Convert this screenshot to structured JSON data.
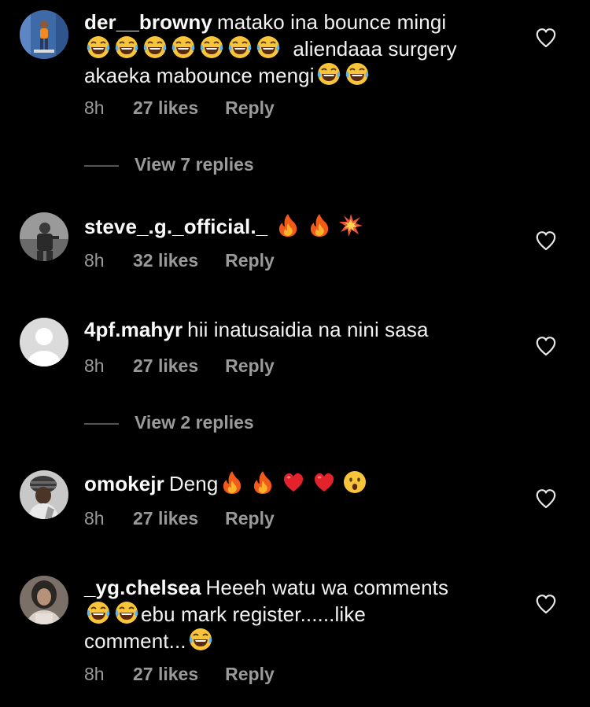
{
  "comments": [
    {
      "username": "der__browny",
      "text_1": "matako ina bounce mingi",
      "text_2": "aliendaaa surgery",
      "text_3": "akaeka mabounce mengi",
      "time": "8h",
      "likes": "27 likes",
      "reply": "Reply",
      "view_replies": "View 7 replies"
    },
    {
      "username": "steve_.g._official._",
      "text_1": "",
      "time": "8h",
      "likes": "32 likes",
      "reply": "Reply"
    },
    {
      "username": "4pf.mahyr",
      "text_1": "hii inatusaidia na nini sasa",
      "time": "8h",
      "likes": "27 likes",
      "reply": "Reply",
      "view_replies": "View 2 replies"
    },
    {
      "username": "omokejr",
      "text_1": "Deng",
      "time": "8h",
      "likes": "27 likes",
      "reply": "Reply"
    },
    {
      "username": "_yg.chelsea",
      "text_1": "Heeeh watu wa comments",
      "text_2": "ebu mark register......like",
      "text_3": "comment...",
      "time": "8h",
      "likes": "27 likes",
      "reply": "Reply"
    }
  ],
  "icons": {
    "like": "heart-outline-icon",
    "laugh": "face-with-tears-of-joy-emoji",
    "fire": "fire-emoji",
    "collision": "collision-emoji",
    "red_heart": "red-heart-emoji",
    "surprised": "face-with-open-mouth-emoji"
  },
  "colors": {
    "background": "#000000",
    "primary_text": "#f5f5f5",
    "secondary_text": "#9a9a9a"
  }
}
